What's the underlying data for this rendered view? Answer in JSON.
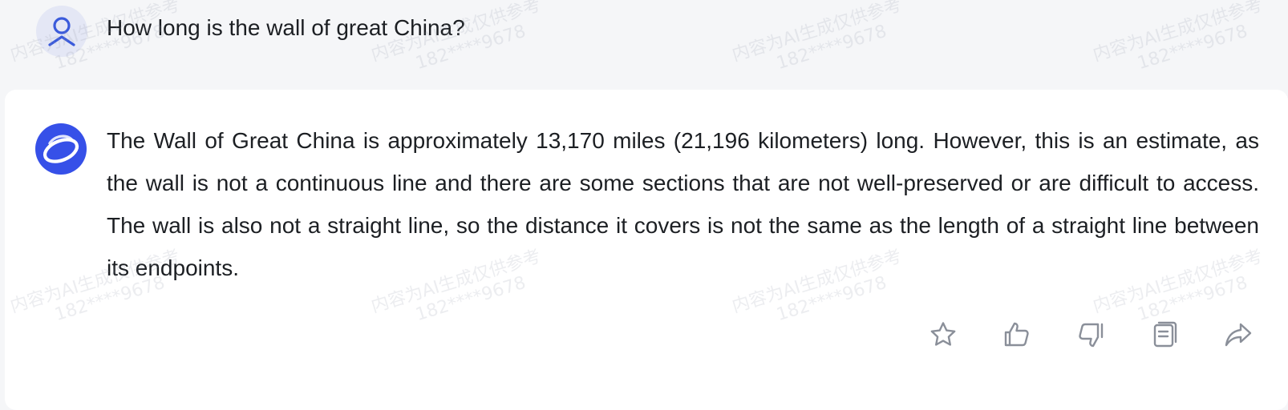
{
  "conversation": {
    "user": {
      "question": "How long is the wall of great China?"
    },
    "assistant": {
      "answer": "The Wall of Great China is approximately 13,170 miles (21,196 kilometers) long. However, this is an estimate, as the wall is not a continuous line and there are some sections that are not well-preserved or are difficult to access. The wall is also not a straight line, so the distance it covers is not the same as the length of a straight line between its endpoints."
    }
  },
  "actions": [
    {
      "id": "favorite",
      "icon": "star-icon"
    },
    {
      "id": "like",
      "icon": "thumbs-up-icon"
    },
    {
      "id": "dislike",
      "icon": "thumbs-down-icon"
    },
    {
      "id": "copy",
      "icon": "copy-icon"
    },
    {
      "id": "share",
      "icon": "share-icon"
    }
  ],
  "watermark": {
    "line1": "内容为AI生成仅供参考",
    "line2": "182****9678"
  },
  "colors": {
    "page_bg": "#f5f6f8",
    "card_bg": "#ffffff",
    "accent": "#3b5bdb",
    "icon_gray": "#8a8f99"
  }
}
